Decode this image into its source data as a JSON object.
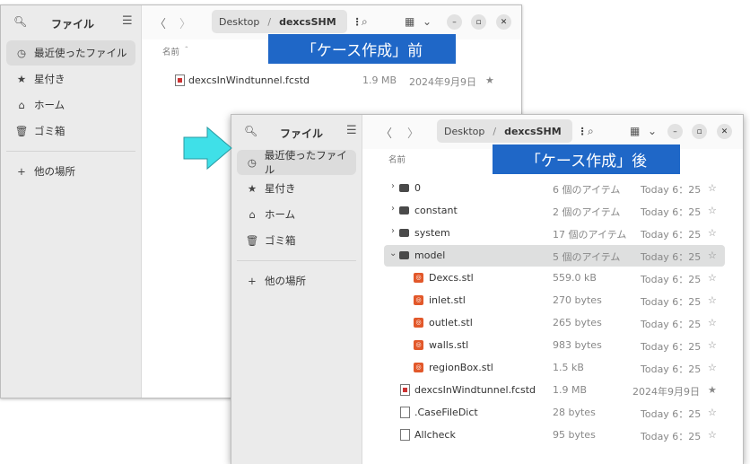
{
  "sidebar": {
    "title": "ファイル",
    "items": [
      {
        "label": "最近使ったファイル",
        "icon": "clock-icon"
      },
      {
        "label": "星付き",
        "icon": "star-icon"
      },
      {
        "label": "ホーム",
        "icon": "home-icon"
      },
      {
        "label": "ゴミ箱",
        "icon": "trash-icon"
      }
    ],
    "other_places": "他の場所"
  },
  "header": {
    "back": "〈",
    "forward": "〉",
    "path_parent": "Desktop",
    "path_sep": "/",
    "path_current": "dexcsSHM",
    "path_menu": "⋮"
  },
  "banners": {
    "before": "「ケース作成」前",
    "after": "「ケース作成」後"
  },
  "colors": {
    "banner": "#1f67c7",
    "arrow": "#3fe0e8",
    "stl": "#e2582a"
  },
  "win1": {
    "col_name": "名前  ＾",
    "files": [
      {
        "name": "dexcsInWindtunnel.fcstd",
        "size": "1.9 MB",
        "date": "2024年9月9日",
        "star": "★"
      }
    ]
  },
  "win2": {
    "col_name": "名前",
    "files": [
      {
        "name": "0",
        "size": "6 個のアイテム",
        "date": "Today 6：25",
        "star": "☆",
        "type": "folder",
        "chev": "›"
      },
      {
        "name": "constant",
        "size": "2 個のアイテム",
        "date": "Today 6：25",
        "star": "☆",
        "type": "folder",
        "chev": "›"
      },
      {
        "name": "system",
        "size": "17 個のアイテム",
        "date": "Today 6：25",
        "star": "☆",
        "type": "folder",
        "chev": "›"
      },
      {
        "name": "model",
        "size": "5 個のアイテム",
        "date": "Today 6：25",
        "star": "☆",
        "type": "folder",
        "chev": "⌄"
      },
      {
        "name": "Dexcs.stl",
        "size": "559.0 kB",
        "date": "Today 6：25",
        "star": "☆",
        "type": "stl"
      },
      {
        "name": "inlet.stl",
        "size": "270 bytes",
        "date": "Today 6：25",
        "star": "☆",
        "type": "stl"
      },
      {
        "name": "outlet.stl",
        "size": "265 bytes",
        "date": "Today 6：25",
        "star": "☆",
        "type": "stl"
      },
      {
        "name": "walls.stl",
        "size": "983 bytes",
        "date": "Today 6：25",
        "star": "☆",
        "type": "stl"
      },
      {
        "name": "regionBox.stl",
        "size": "1.5 kB",
        "date": "Today 6：25",
        "star": "☆",
        "type": "stl"
      },
      {
        "name": "dexcsInWindtunnel.fcstd",
        "size": "1.9 MB",
        "date": "2024年9月9日",
        "star": "★",
        "type": "fcstd"
      },
      {
        "name": ".CaseFileDict",
        "size": "28 bytes",
        "date": "Today 6：25",
        "star": "☆",
        "type": "doc"
      },
      {
        "name": "Allcheck",
        "size": "95 bytes",
        "date": "Today 6：25",
        "star": "☆",
        "type": "doc"
      }
    ]
  }
}
